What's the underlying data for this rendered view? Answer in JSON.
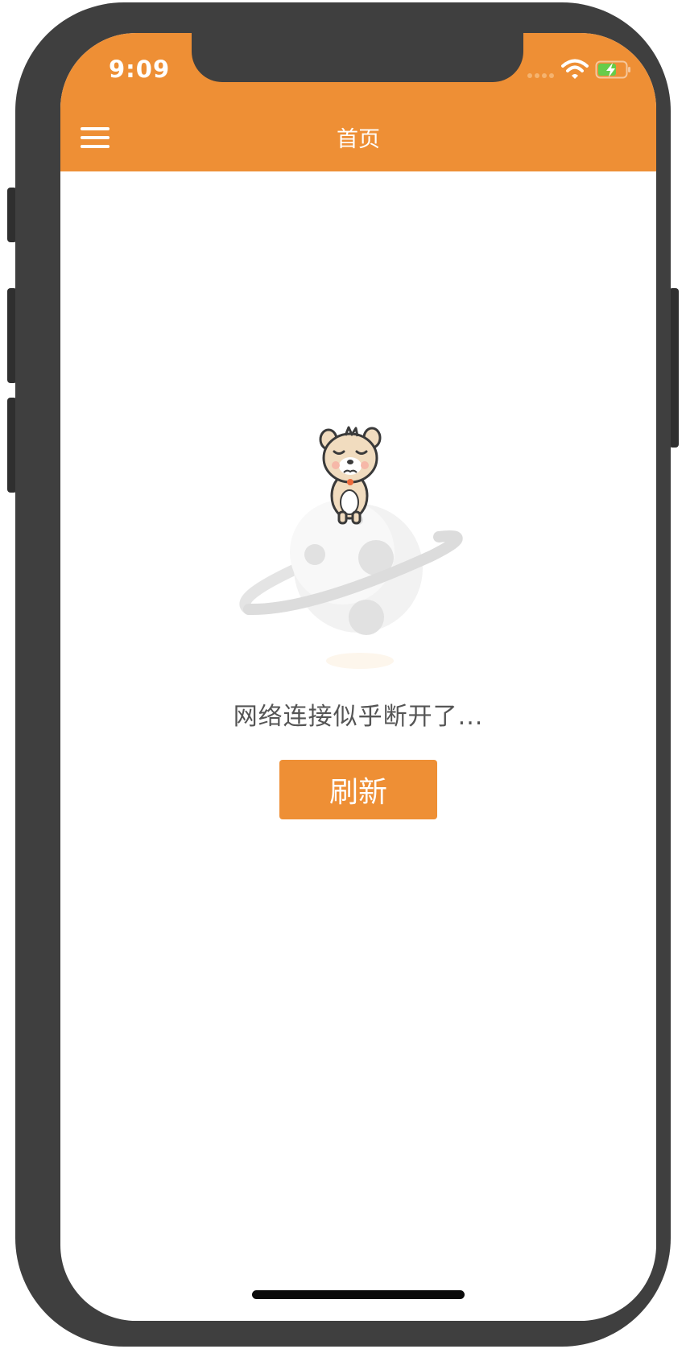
{
  "status_bar": {
    "time": "9:09"
  },
  "header": {
    "title": "首页",
    "menu_icon": "hamburger-menu-icon"
  },
  "empty_state": {
    "illustration": "bear-on-planet-illustration",
    "message": "网络连接似乎断开了...",
    "button_label": "刷新"
  },
  "colors": {
    "accent": "#ee8f35",
    "device_frame": "#3f3f3f",
    "message_text": "#555555"
  }
}
